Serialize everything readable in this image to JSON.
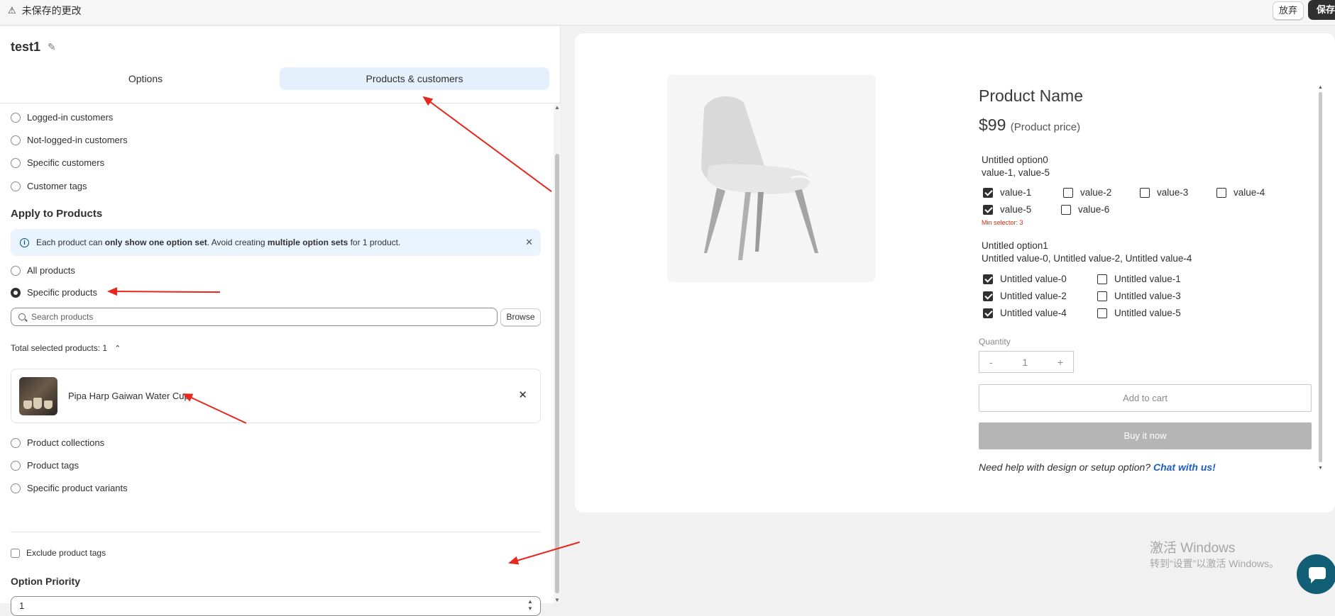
{
  "topbar": {
    "warning_icon": "warning-triangle-icon",
    "unsaved_text": "未保存的更改",
    "discard_label": "放弃",
    "save_label": "保存"
  },
  "editor": {
    "title": "test1",
    "tabs": [
      {
        "label": "Options",
        "active": false
      },
      {
        "label": "Products & customers",
        "active": true
      }
    ],
    "customer_options": [
      "Logged-in customers",
      "Not-logged-in customers",
      "Specific customers",
      "Customer tags"
    ],
    "apply_heading": "Apply to Products",
    "banner": {
      "pre": "Each product can ",
      "b1": "only show one option set",
      "mid": ". Avoid creating ",
      "b2": "multiple option sets",
      "post": " for 1 product."
    },
    "product_options_top": [
      "All products",
      "Specific products"
    ],
    "selected_radio": "Specific products",
    "search_placeholder": "Search products",
    "browse_label": "Browse",
    "total_selected": "Total selected products: 1",
    "selected_product": "Pipa Harp Gaiwan Water Cup",
    "product_options_bottom": [
      "Product collections",
      "Product tags",
      "Specific product variants"
    ],
    "exclude_label": "Exclude product tags",
    "priority_heading": "Option Priority",
    "priority_value": "1"
  },
  "preview": {
    "product_name": "Product Name",
    "price": "$99",
    "price_note": "(Product price)",
    "option0": {
      "title": "Untitled option0",
      "selected": "value-1, value-5",
      "values": [
        {
          "label": "value-1",
          "checked": true
        },
        {
          "label": "value-2",
          "checked": false
        },
        {
          "label": "value-3",
          "checked": false
        },
        {
          "label": "value-4",
          "checked": false
        },
        {
          "label": "value-5",
          "checked": true
        },
        {
          "label": "value-6",
          "checked": false
        }
      ],
      "min_selector": "Min selector: 3"
    },
    "option1": {
      "title": "Untitled option1",
      "selected": "Untitled value-0, Untitled value-2, Untitled value-4",
      "values": [
        {
          "label": "Untitled value-0",
          "checked": true
        },
        {
          "label": "Untitled value-1",
          "checked": false
        },
        {
          "label": "Untitled value-2",
          "checked": true
        },
        {
          "label": "Untitled value-3",
          "checked": false
        },
        {
          "label": "Untitled value-4",
          "checked": true
        },
        {
          "label": "Untitled value-5",
          "checked": false
        }
      ]
    },
    "quantity_label": "Quantity",
    "quantity_minus": "-",
    "quantity_value": "1",
    "quantity_plus": "+",
    "add_to_cart": "Add to cart",
    "buy_now": "Buy it now",
    "help_text": "Need help with design or setup option?",
    "help_link": "Chat with us!"
  },
  "watermark": {
    "line1": "激活 Windows",
    "line2": "转到“设置”以激活 Windows。"
  },
  "colors": {
    "accent_tab": "#e4f1fc",
    "annotation_arrow": "#e8261c",
    "chat_button": "#135e77",
    "error_text": "#d82c0d",
    "link": "#1d5fc4"
  }
}
